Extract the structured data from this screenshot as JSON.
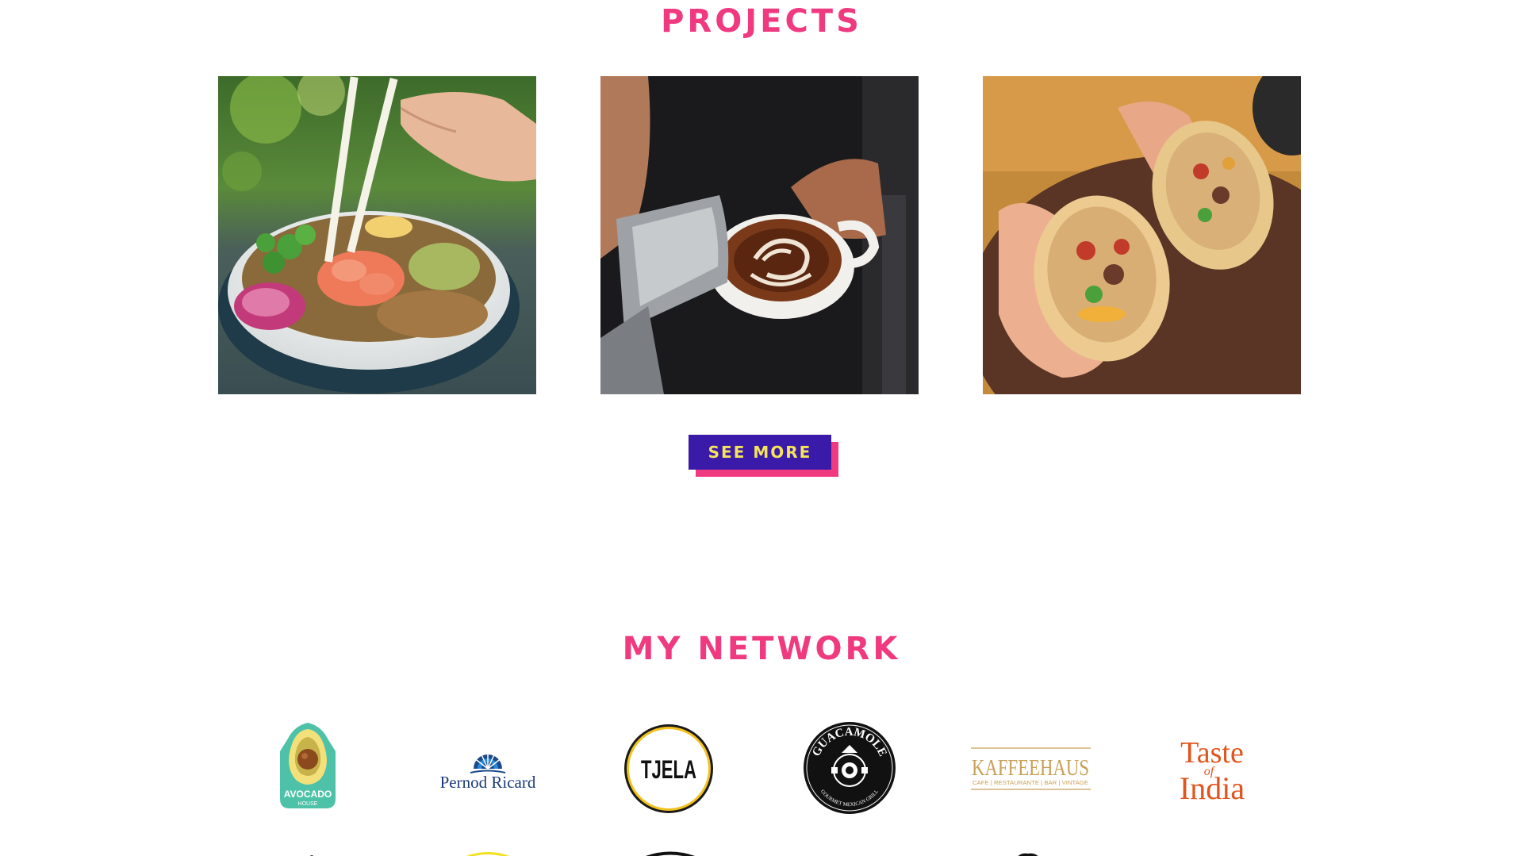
{
  "projects": {
    "title": "PROJECTS",
    "tiles": [
      {
        "alt": "poke bowl with chopsticks"
      },
      {
        "alt": "latte art being poured"
      },
      {
        "alt": "burrito halves held in hands"
      }
    ],
    "see_more_label": "SEE MORE"
  },
  "network": {
    "title": "MY NETWORK",
    "logos": [
      {
        "name": "Avocado House",
        "lines": [
          "AVOCADO",
          "HOUSE"
        ]
      },
      {
        "name": "Pernod Ricard",
        "text": "Pernod Ricard"
      },
      {
        "name": "TJELA",
        "text": "TJELA"
      },
      {
        "name": "Guacamole",
        "top": "GUACAMOLE",
        "bottom": "GOURMET MEXICAN GRILL"
      },
      {
        "name": "Kaffeehaus",
        "text": "KAFFEEHAUS",
        "sub": "CAFE | RESTAURANTE | BAR | VINTAGE"
      },
      {
        "name": "Taste of India",
        "lines": [
          "Taste",
          "of",
          "India"
        ]
      }
    ]
  },
  "colors": {
    "accent_pink": "#f03a80",
    "button_bg": "#3a1aa8",
    "button_text": "#f5e35a",
    "background": "#ffffff"
  }
}
